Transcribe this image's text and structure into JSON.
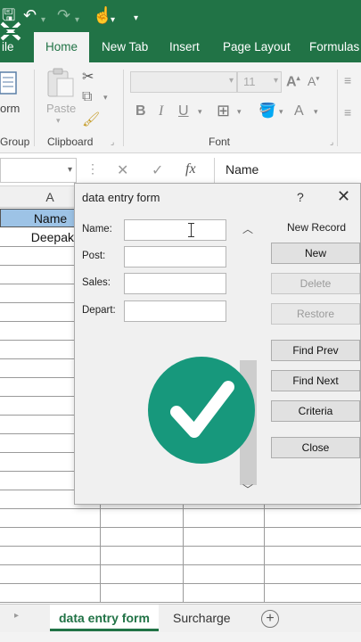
{
  "titlebar": {
    "accent": "#217346"
  },
  "ribbon_tabs": {
    "file": "ile",
    "home": "Home",
    "new_tab": "New Tab",
    "insert": "Insert",
    "page_layout": "Page Layout",
    "formulas": "Formulas"
  },
  "ribbon": {
    "group_label": "Group",
    "form_label": "orm",
    "paste_label": "Paste",
    "clipboard_label": "Clipboard",
    "font_label": "Font",
    "font_size": "11"
  },
  "formula_bar": {
    "fx": "fx",
    "content": "Name"
  },
  "grid": {
    "column_header": "A",
    "cells": {
      "a1": "Name",
      "a2": "Deepak"
    }
  },
  "dialog": {
    "title": "data entry form",
    "help": "?",
    "close": "✕",
    "record_status": "New Record",
    "fields": {
      "name": "Name:",
      "post": "Post:",
      "sales": "Sales:",
      "depart": "Depart:"
    },
    "buttons": {
      "new": "New",
      "delete": "Delete",
      "restore": "Restore",
      "find_prev": "Find Prev",
      "find_next": "Find Next",
      "criteria": "Criteria",
      "close": "Close"
    }
  },
  "sheets": {
    "active": "data entry form",
    "other": "Surcharge",
    "add": "+"
  },
  "overlay": {
    "icon": "checkmark-icon",
    "color": "#17987c"
  }
}
